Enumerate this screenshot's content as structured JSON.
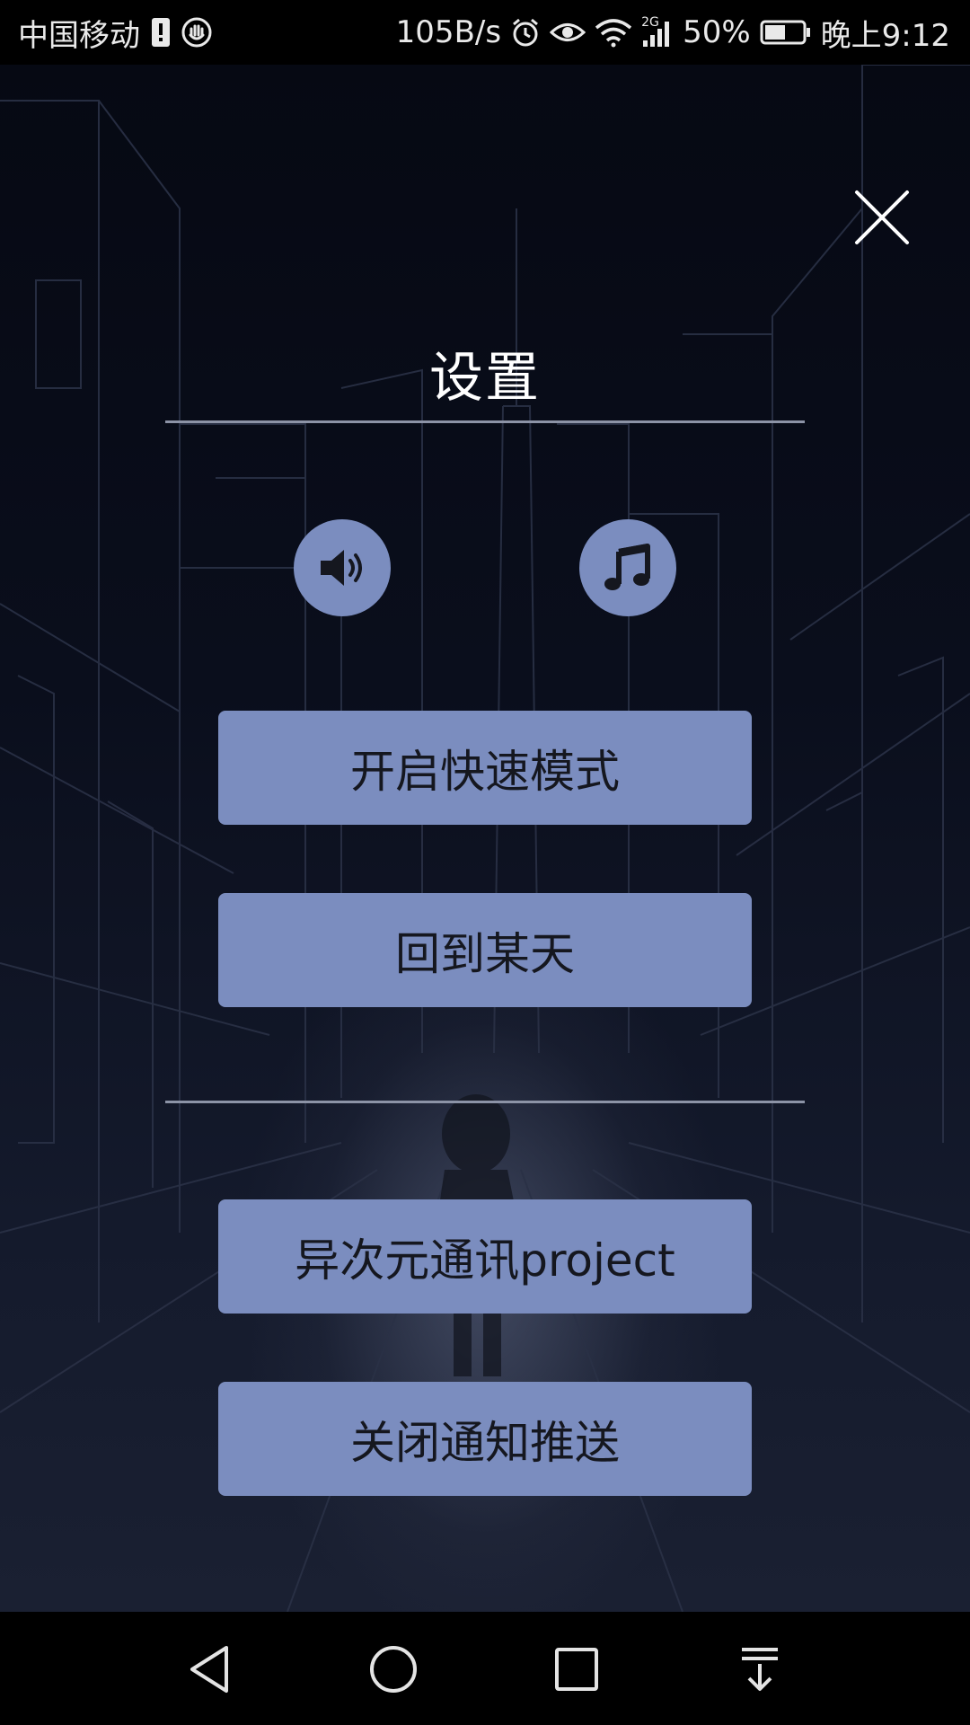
{
  "status_bar": {
    "carrier": "中国移动",
    "speed": "105B/s",
    "network": "2G",
    "battery": "50%",
    "time": "晚上9:12",
    "icons": [
      "sim-alert-icon",
      "hand-icon",
      "alarm-icon",
      "eye-icon",
      "wifi-icon",
      "signal-icon",
      "battery-icon"
    ]
  },
  "page": {
    "title": "设置",
    "close_icon": "close-icon"
  },
  "toggles": {
    "sound_icon": "speaker-icon",
    "music_icon": "music-note-icon"
  },
  "buttons": {
    "fast_mode": "开启快速模式",
    "back_to_day": "回到某天",
    "project": "异次元通讯project",
    "disable_push": "关闭通知推送"
  },
  "nav_bar": {
    "icons": [
      "back-icon",
      "home-icon",
      "recents-icon",
      "notification-pull-icon"
    ]
  },
  "colors": {
    "button": "#7b8dbf",
    "button_text": "#15171f",
    "background": "#070a14",
    "divider": "#8c93a6"
  }
}
